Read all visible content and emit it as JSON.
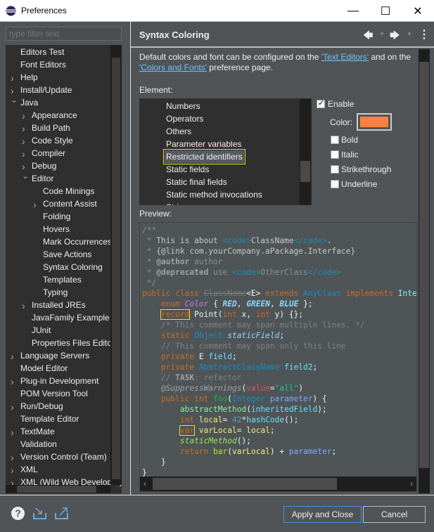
{
  "window": {
    "title": "Preferences",
    "minimize": "—",
    "maximize": "☐",
    "close": "✕"
  },
  "filter": {
    "placeholder": "type filter text",
    "value": ""
  },
  "tree": [
    {
      "label": "Editors Test",
      "level": 0,
      "exp": ""
    },
    {
      "label": "Font Editors",
      "level": 0,
      "exp": ""
    },
    {
      "label": "Help",
      "level": 0,
      "exp": "closed"
    },
    {
      "label": "Install/Update",
      "level": 0,
      "exp": "closed"
    },
    {
      "label": "Java",
      "level": 0,
      "exp": "open"
    },
    {
      "label": "Appearance",
      "level": 1,
      "exp": "closed"
    },
    {
      "label": "Build Path",
      "level": 1,
      "exp": "closed"
    },
    {
      "label": "Code Style",
      "level": 1,
      "exp": "closed"
    },
    {
      "label": "Compiler",
      "level": 1,
      "exp": "closed"
    },
    {
      "label": "Debug",
      "level": 1,
      "exp": "closed"
    },
    {
      "label": "Editor",
      "level": 1,
      "exp": "open"
    },
    {
      "label": "Code Minings",
      "level": 2,
      "exp": ""
    },
    {
      "label": "Content Assist",
      "level": 2,
      "exp": "closed"
    },
    {
      "label": "Folding",
      "level": 2,
      "exp": ""
    },
    {
      "label": "Hovers",
      "level": 2,
      "exp": ""
    },
    {
      "label": "Mark Occurrences",
      "level": 2,
      "exp": ""
    },
    {
      "label": "Save Actions",
      "level": 2,
      "exp": ""
    },
    {
      "label": "Syntax Coloring",
      "level": 2,
      "exp": "",
      "selected": true
    },
    {
      "label": "Templates",
      "level": 2,
      "exp": ""
    },
    {
      "label": "Typing",
      "level": 2,
      "exp": ""
    },
    {
      "label": "Installed JREs",
      "level": 1,
      "exp": "closed"
    },
    {
      "label": "JavaFamily Example",
      "level": 1,
      "exp": ""
    },
    {
      "label": "JUnit",
      "level": 1,
      "exp": ""
    },
    {
      "label": "Properties Files Editor",
      "level": 1,
      "exp": ""
    },
    {
      "label": "Language Servers",
      "level": 0,
      "exp": "closed"
    },
    {
      "label": "Model Editor",
      "level": 0,
      "exp": ""
    },
    {
      "label": "Plug-in Development",
      "level": 0,
      "exp": "closed"
    },
    {
      "label": "POM Version Tool",
      "level": 0,
      "exp": ""
    },
    {
      "label": "Run/Debug",
      "level": 0,
      "exp": "closed"
    },
    {
      "label": "Template Editor",
      "level": 0,
      "exp": ""
    },
    {
      "label": "TextMate",
      "level": 0,
      "exp": "closed"
    },
    {
      "label": "Validation",
      "level": 0,
      "exp": ""
    },
    {
      "label": "Version Control (Team)",
      "level": 0,
      "exp": "closed"
    },
    {
      "label": "XML",
      "level": 0,
      "exp": "closed"
    },
    {
      "label": "XML (Wild Web Developer)",
      "level": 0,
      "exp": "closed"
    }
  ],
  "page": {
    "title": "Syntax Coloring",
    "nav": {
      "back": "🡄",
      "forward": "🡆",
      "menu": "⋮"
    },
    "desc_1": "Default colors and font can be configured on the ",
    "link_text_editors": "'Text Editors'",
    "desc_2": " and on the ",
    "link_colors_fonts": "'Colors and Fonts'",
    "desc_3": " preference page.",
    "element_label": "Element:",
    "elements": [
      "Numbers",
      "Operators",
      "Others",
      "Parameter variables",
      "Restricted identifiers",
      "Static fields",
      "Static final fields",
      "Static method invocations",
      "Strings"
    ],
    "selected_element": "Restricted identifiers",
    "enable": {
      "label": "Enable",
      "checked": true
    },
    "color_label": "Color:",
    "color_value": "#ff8040",
    "options": [
      {
        "label": "Bold",
        "checked": false
      },
      {
        "label": "Italic",
        "checked": false
      },
      {
        "label": "Strikethrough",
        "checked": false
      },
      {
        "label": "Underline",
        "checked": false
      }
    ],
    "preview_label": "Preview:"
  },
  "code": [
    [
      [
        "jd",
        "/**"
      ]
    ],
    [
      [
        "jd",
        " * "
      ],
      [
        "jt",
        "This is about "
      ],
      [
        "tg",
        "<code>"
      ],
      [
        "jt",
        "ClassName"
      ],
      [
        "tg",
        "</code>"
      ],
      [
        "jt",
        "."
      ]
    ],
    [
      [
        "jd",
        " * "
      ],
      [
        "jt",
        "{@link com.yourCompany.aPackage.Interface}"
      ]
    ],
    [
      [
        "jd",
        " * "
      ],
      [
        "jb",
        "@author"
      ],
      [
        "jd",
        " author"
      ]
    ],
    [
      [
        "jd",
        " * "
      ],
      [
        "jb",
        "@deprecated"
      ],
      [
        "jd",
        " use "
      ],
      [
        "tg",
        "<code>"
      ],
      [
        "jd",
        "OtherClass"
      ],
      [
        "tg",
        "</code>"
      ]
    ],
    [
      [
        "jd",
        " */"
      ]
    ],
    [
      [
        "kw",
        "public class "
      ],
      [
        "st",
        "ClassName"
      ],
      [
        "pl",
        "<E> "
      ],
      [
        "kw",
        "extends "
      ],
      [
        "ty",
        "AnyClass "
      ],
      [
        "kw",
        "implements "
      ],
      [
        "in",
        "Interface"
      ]
    ],
    [
      [
        "pl",
        "    "
      ],
      [
        "kw",
        "enum "
      ],
      [
        "en",
        "Color"
      ],
      [
        "pl",
        " { "
      ],
      [
        "ec",
        "RED"
      ],
      [
        "pl",
        ", "
      ],
      [
        "ec",
        "GREEN"
      ],
      [
        "pl",
        ", "
      ],
      [
        "ec",
        "BLUE"
      ],
      [
        "pl",
        " };"
      ]
    ],
    [
      [
        "pl",
        "    "
      ],
      [
        "kw bx",
        "record"
      ],
      [
        "pl",
        " Point("
      ],
      [
        "kw",
        "int"
      ],
      [
        "pl",
        " x, "
      ],
      [
        "kw",
        "int"
      ],
      [
        "pl",
        " y) {};"
      ]
    ],
    [
      [
        "cm",
        "    /* This comment may span multiple lines. */"
      ]
    ],
    [
      [
        "pl",
        "    "
      ],
      [
        "kw",
        "static "
      ],
      [
        "ty",
        "Object "
      ],
      [
        "sf",
        "staticField"
      ],
      [
        "pl",
        ";"
      ]
    ],
    [
      [
        "cm",
        "    // This comment may span only this line"
      ]
    ],
    [
      [
        "pl",
        "    "
      ],
      [
        "kw",
        "private "
      ],
      [
        "pl",
        "E "
      ],
      [
        "fi",
        "field"
      ],
      [
        "pl",
        ";"
      ]
    ],
    [
      [
        "pl",
        "    "
      ],
      [
        "kw",
        "private "
      ],
      [
        "ty",
        "AbstractClassName "
      ],
      [
        "fi",
        "field2"
      ],
      [
        "pl",
        ";"
      ]
    ],
    [
      [
        "cm",
        "    // "
      ],
      [
        "jb",
        "TASK"
      ],
      [
        "cm",
        ": refactor"
      ]
    ],
    [
      [
        "pl",
        "    "
      ],
      [
        "an",
        "@SuppressWarnings"
      ],
      [
        "pl",
        "("
      ],
      [
        "av",
        "value"
      ],
      [
        "pl",
        "="
      ],
      [
        "sv",
        "\"all\""
      ],
      [
        "pl",
        ")"
      ]
    ],
    [
      [
        "pl",
        "    "
      ],
      [
        "kw",
        "public int "
      ],
      [
        "md",
        "foo"
      ],
      [
        "pl",
        "("
      ],
      [
        "ty",
        "Integer "
      ],
      [
        "pa",
        "parameter"
      ],
      [
        "pl",
        ") {"
      ]
    ],
    [
      [
        "pl",
        "        "
      ],
      [
        "am",
        "abstractMethod"
      ],
      [
        "pl",
        "("
      ],
      [
        "fi",
        "inheritedField"
      ],
      [
        "pl",
        ");"
      ]
    ],
    [
      [
        "pl",
        "        "
      ],
      [
        "kw",
        "int "
      ],
      [
        "lv",
        "local"
      ],
      [
        "pl",
        "= "
      ],
      [
        "nu",
        "42"
      ],
      [
        "pl",
        "*"
      ],
      [
        "fi",
        "hashCode"
      ],
      [
        "pl",
        "();"
      ]
    ],
    [
      [
        "pl",
        "        "
      ],
      [
        "kw bx",
        "var"
      ],
      [
        "pl",
        " "
      ],
      [
        "lv",
        "varLocal"
      ],
      [
        "pl",
        "= "
      ],
      [
        "lv",
        "local"
      ],
      [
        "pl",
        ";"
      ]
    ],
    [
      [
        "pl",
        "        "
      ],
      [
        "smi",
        "staticMethod"
      ],
      [
        "pl",
        "();"
      ]
    ],
    [
      [
        "pl",
        "        "
      ],
      [
        "kw",
        "return "
      ],
      [
        "mi",
        "bar"
      ],
      [
        "pl",
        "("
      ],
      [
        "lv",
        "varLocal"
      ],
      [
        "pl",
        ") + "
      ],
      [
        "pa",
        "parameter"
      ],
      [
        "pl",
        ";"
      ]
    ],
    [
      [
        "pl",
        "    }"
      ]
    ],
    [
      [
        "pl",
        "}"
      ]
    ]
  ],
  "footer": {
    "apply_close": "Apply and Close",
    "cancel": "Cancel",
    "icons": [
      "help-icon",
      "import-icon",
      "export-icon"
    ]
  },
  "colors": {
    "accent": "#3b8eea",
    "highlight_box": "#f0e000",
    "selection": "#555a5e"
  }
}
